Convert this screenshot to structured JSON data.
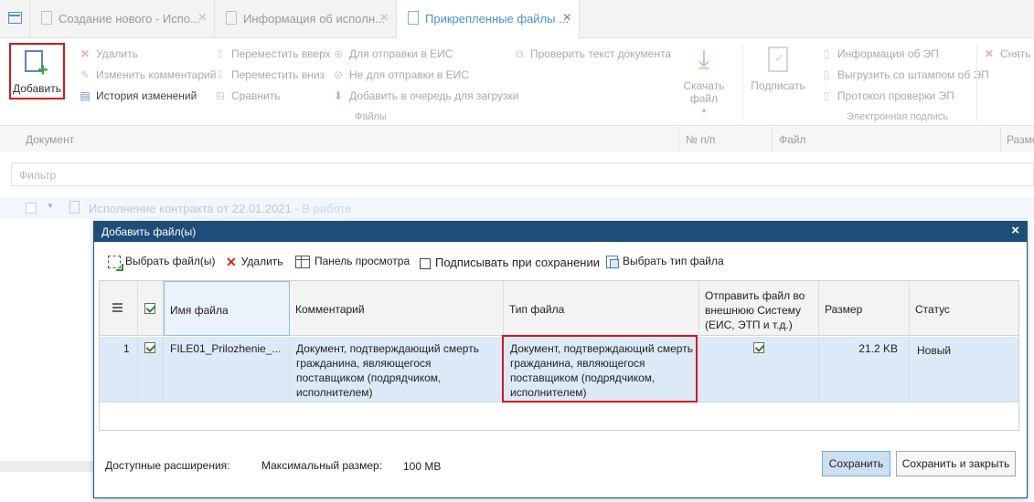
{
  "tabs": [
    {
      "label": "Создание нового - Испо..."
    },
    {
      "label": "Информация об исполн..."
    },
    {
      "label": "Прикрепленные файлы ..."
    }
  ],
  "ribbon": {
    "add_label": "Добавить",
    "delete": "Удалить",
    "edit_comment": "Изменить комментарий",
    "history": "История изменений",
    "move_up": "Переместить вверх",
    "move_down": "Переместить вниз",
    "compare": "Сравнить",
    "for_eis": "Для отправки в ЕИС",
    "not_for_eis": "Не для отправки в ЕИС",
    "queue": "Добавить в очередь для загрузки",
    "check_text": "Проверить текст документа",
    "download": "Скачать файл",
    "files_group": "Файлы",
    "sign": "Подписать",
    "ep_info": "Информация об ЭП",
    "export_stamp": "Выгрузить со штампом об ЭП",
    "ep_protocol": "Протокол проверки ЭП",
    "ep_group": "Электронная подпись",
    "remove_cut": "Снять Э"
  },
  "grid": {
    "col_document": "Документ",
    "col_num": "№ п/п",
    "col_file": "Файл",
    "col_size": "Разме",
    "filter_placeholder": "Фильтр",
    "group_title": "Исполнение контракта от 22.01.2021",
    "group_status": " - В работе"
  },
  "dialog": {
    "title": "Добавить файл(ы)",
    "close": "×",
    "toolbar": {
      "select_files": "Выбрать файл(ы)",
      "delete": "Удалить",
      "preview_panel": "Панель просмотра",
      "sign_on_save": "Подписывать при сохранении",
      "select_type": "Выбрать тип файла"
    },
    "columns": {
      "name": "Имя файла",
      "comment": "Комментарий",
      "type": "Тип файла",
      "send": "Отправить файл во внешнюю Систему (ЕИС, ЭТП и т.д.)",
      "size": "Размер",
      "status": "Статус"
    },
    "rows": [
      {
        "num": "1",
        "name": "FILE01_Prilozhenie_...",
        "comment": "Документ, подтверждающий смерть гражданина, являющегося поставщиком (подрядчиком, исполнителем)",
        "type": "Документ, подтверждающий смерть гражданина, являющегося поставщиком (подрядчиком, исполнителем)",
        "size": "21.2 KB",
        "status": "Новый"
      }
    ],
    "footer": {
      "extensions_label": "Доступные расширения:",
      "max_size_label": "Максимальный размер:",
      "max_size_value": "100 MB"
    },
    "save": "Сохранить",
    "save_close": "Сохранить и закрыть"
  },
  "colors": {
    "dialog_title_bg": "#1e4d7a",
    "highlight_red": "#d9161b",
    "selected_row": "#dceaf7"
  }
}
